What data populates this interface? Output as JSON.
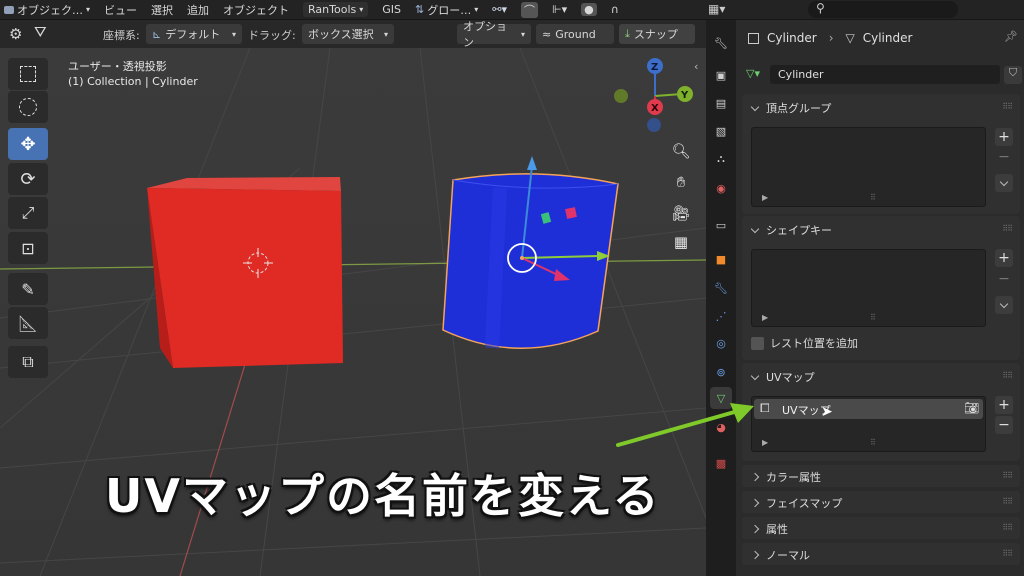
{
  "topbar": {
    "mode": "オブジェク…",
    "menu": [
      "ビュー",
      "選択",
      "追加",
      "オブジェクト"
    ],
    "rantools": "RanTools",
    "gis": "GIS",
    "orientation": "グロー…"
  },
  "subbar": {
    "coord_label": "座標系:",
    "coord_value": "デフォルト",
    "drag_label": "ドラッグ:",
    "drag_value": "ボックス選択",
    "options": "オプション",
    "ground": "Ground",
    "snap": "スナップ"
  },
  "viewport": {
    "view_name": "ユーザー・透視投影",
    "collection": "(1) Collection | Cylinder",
    "gizmo": {
      "z": "Z",
      "y": "Y",
      "x": "X"
    }
  },
  "properties": {
    "breadcrumb_left": "Cylinder",
    "breadcrumb_right": "Cylinder",
    "mesh_name": "Cylinder",
    "panels": {
      "vertex_groups": "頂点グループ",
      "shape_keys": "シェイプキー",
      "rest_position": "レスト位置を追加",
      "uv_maps": "UVマップ",
      "color_attr": "カラー属性",
      "face_maps": "フェイスマップ",
      "attributes": "属性",
      "normals": "ノーマル"
    },
    "uv_item": "UVマップ"
  },
  "caption": "UVマップの名前を変える",
  "colors": {
    "accent": "#4772b3",
    "cube": "#e02a24",
    "cylinder": "#1f2fd8",
    "arrow": "#7fc92a",
    "selection": "#f5a35a"
  }
}
